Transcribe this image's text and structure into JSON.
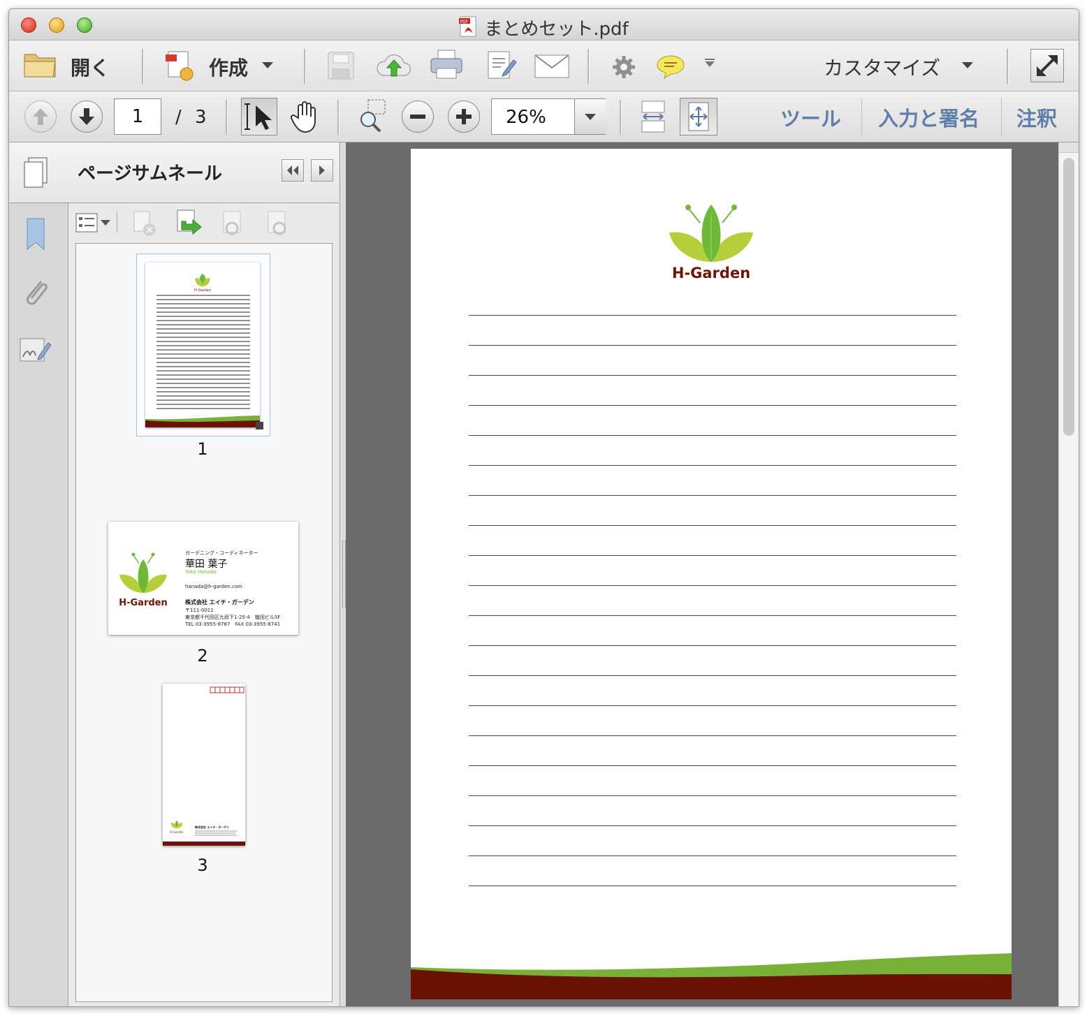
{
  "window": {
    "title": "まとめセット.pdf"
  },
  "toolbar": {
    "open_label": "開く",
    "create_label": "作成",
    "customize_label": "カスタマイズ"
  },
  "navbar": {
    "current_page": "1",
    "page_separator": "/",
    "total_pages": "3",
    "zoom_value": "26%",
    "tools_label": "ツール",
    "sign_label": "入力と署名",
    "comment_label": "注釈"
  },
  "sidebar": {
    "panel_title": "ページサムネール",
    "thumbnails": [
      {
        "label": "1"
      },
      {
        "label": "2"
      },
      {
        "label": "3"
      }
    ]
  },
  "business_card": {
    "job_title": "ガーデニング・コーディネーター",
    "name": "華田 葉子",
    "name_roman": "Yoko Hanada",
    "email": "hanada@h-garden.com",
    "company": "株式会社 エイチ・ガーデン",
    "postal": "〒111-0011",
    "address": "東京都千代田区九段下1-25-4　植田ビル5F",
    "phone": "TEL 03-3955-8787　FAX 03-3955-8741"
  },
  "envelope": {
    "company": "株式会社 エイチ・ガーデン"
  },
  "document": {
    "logo_text": "H-Garden",
    "rule_count": 20
  },
  "colors": {
    "leaf_light": "#b5cf3a",
    "leaf_dark": "#6fb93a",
    "logo_text": "#6e1408",
    "footer_green": "#78b038",
    "footer_brown": "#6a1204",
    "link_blue": "#5f7fa8"
  }
}
